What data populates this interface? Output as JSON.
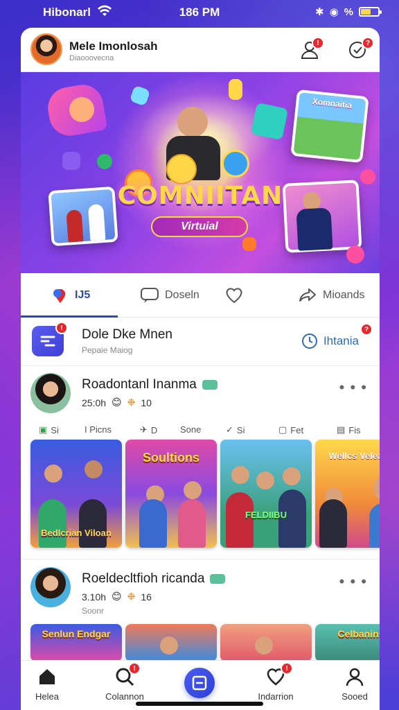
{
  "status_bar": {
    "carrier": "Hibonarl",
    "time": "186 PM",
    "battery": "%"
  },
  "header": {
    "name": "Mele Imonlosah",
    "subtitle": "Diaooovecna",
    "notif_badge": "!",
    "msg_badge": "?"
  },
  "hero": {
    "title": "COMNIITAN",
    "pill": "Virtuial",
    "frame_label": "Xomnaitia"
  },
  "tabs": [
    {
      "label": "IJ5"
    },
    {
      "label": "Doseln"
    },
    {
      "label": ""
    },
    {
      "label": "Mioands"
    }
  ],
  "group": {
    "title": "Dole Dke Mnen",
    "subtitle": "Pepaie Maiog",
    "action": "Ihtania",
    "badge": "!",
    "action_badge": "?"
  },
  "post1": {
    "name": "Roadontanl Inanma",
    "time": "25:0h",
    "count": "10",
    "actions": [
      "Si",
      "I Picns",
      "D",
      "Sone",
      "Si",
      "Fet",
      "Fis"
    ],
    "thumbs": [
      {
        "label": "Bedlcrian Viloan"
      },
      {
        "label": "Soultions"
      },
      {
        "label": "FELDIIBU"
      },
      {
        "label": "Wellcs Veleans"
      }
    ]
  },
  "post2": {
    "name": "Roeldecltfioh ricanda",
    "time": "3.10h",
    "count": "16",
    "sub": "Soonr",
    "thumbs": [
      {
        "label": "Senlun Endgar"
      },
      {
        "label": ""
      },
      {
        "label": ""
      },
      {
        "label": "Celbanins"
      }
    ]
  },
  "bottom_nav": [
    {
      "label": "Helea"
    },
    {
      "label": "Colannon"
    },
    {
      "label": ""
    },
    {
      "label": "Indarrion"
    },
    {
      "label": "Sooed"
    }
  ],
  "colors": {
    "accent": "#2a4aa8",
    "badge": "#e8262c",
    "center_button": "#3a4ce8"
  }
}
